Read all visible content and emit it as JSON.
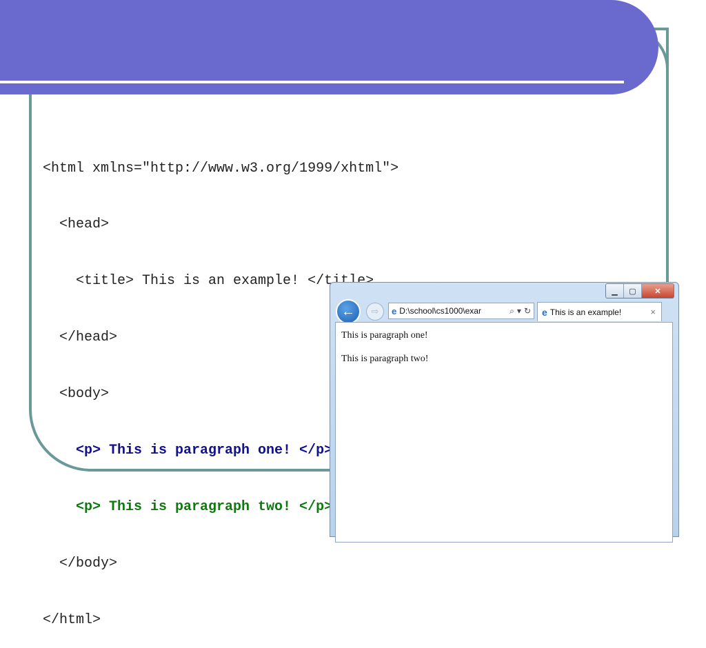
{
  "code_lines": [
    "<html xmlns=\"http://www.w3.org/1999/xhtml\">",
    "  <head>",
    "    <title> This is an example! </title>",
    "  </head>",
    "  <body>",
    "    <p> This is paragraph one! </p>",
    "    <p> This is paragraph two! </p>",
    "  </body>",
    "</html>"
  ],
  "browser": {
    "address": "D:\\school\\cs1000\\exar",
    "tab_title": "This is an example!",
    "tab_close": "×",
    "window_buttons": {
      "minimize": "▁",
      "maximize": "▢",
      "close": "✕"
    },
    "back_icon": "←",
    "forward_icon": "⇨",
    "search_icon": "⌕",
    "dropdown_icon": "▾",
    "refresh_icon": "↻",
    "paragraphs": [
      "This is paragraph one!",
      "This is paragraph two!"
    ]
  },
  "colors": {
    "banner": "#6a6ace",
    "frame": "#6a9a98",
    "code_blue": "#101090",
    "code_green": "#0e7a0e"
  }
}
